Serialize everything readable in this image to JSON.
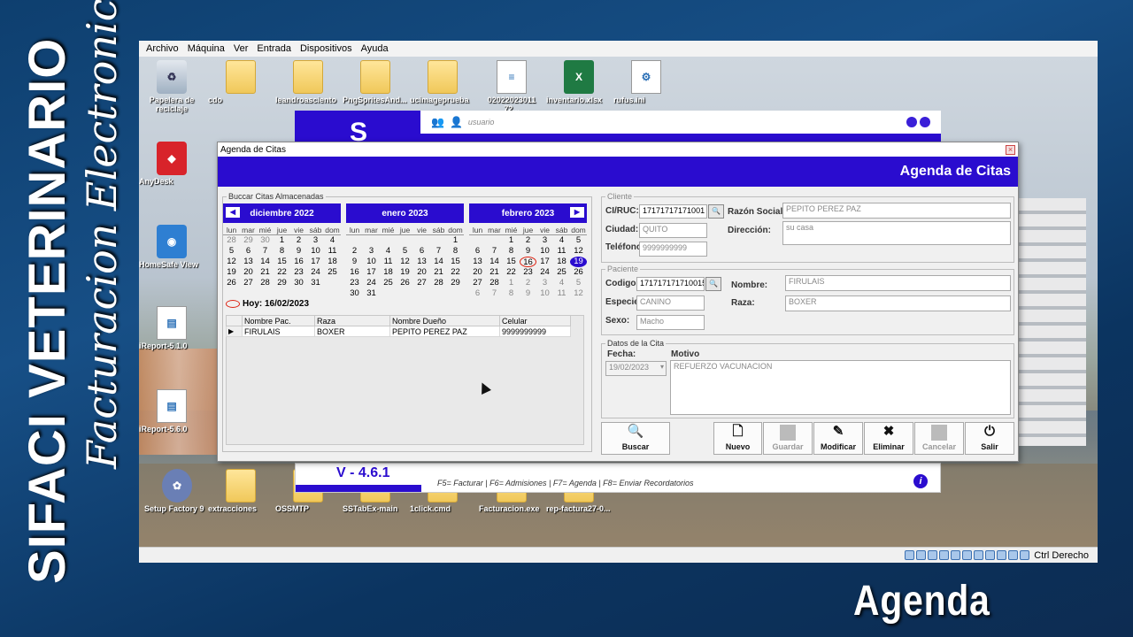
{
  "overlay": {
    "brand_title": "SIFACI VETERINARIO",
    "brand_subtitle": "Facturacion Electronica",
    "corner_label": "Agenda"
  },
  "vm_menu": [
    "Archivo",
    "Máquina",
    "Ver",
    "Entrada",
    "Dispositivos",
    "Ayuda"
  ],
  "vm_status": {
    "host_key": "Ctrl Derecho"
  },
  "desktop_icons": [
    {
      "label": "Papelera de reciclaje",
      "icon": "recycle-bin-icon"
    },
    {
      "label": "cdo",
      "icon": "folder-icon"
    },
    {
      "label": "leandroasciento",
      "icon": "folder-icon"
    },
    {
      "label": "PngSpritesAnd...",
      "icon": "folder-icon"
    },
    {
      "label": "ucimageprueba",
      "icon": "folder-icon"
    },
    {
      "label": "02022023011 72...",
      "icon": "document-icon"
    },
    {
      "label": "inventario.xlsx",
      "icon": "excel-icon"
    },
    {
      "label": "rufus.ini",
      "icon": "settings-file-icon"
    },
    {
      "label": "AnyDesk",
      "icon": "anydesk-icon"
    },
    {
      "label": "HomeSafe View",
      "icon": "homesafe-icon"
    },
    {
      "label": "iReport-5.1.0",
      "icon": "ireport-icon"
    },
    {
      "label": "iReport-5.6.0",
      "icon": "ireport-icon"
    },
    {
      "label": "Setup Factory 9",
      "icon": "setup-factory-icon"
    },
    {
      "label": "extracciones",
      "icon": "folder-icon"
    },
    {
      "label": "OSSMTP",
      "icon": "folder-icon"
    },
    {
      "label": "SSTabEx-main",
      "icon": "folder-icon"
    },
    {
      "label": "1click.cmd",
      "icon": "folder-icon"
    },
    {
      "label": "Facturacion.exe",
      "icon": "folder-icon"
    },
    {
      "label": "rep-factura27-0...",
      "icon": "folder-icon"
    }
  ],
  "main_app": {
    "user": "usuario",
    "logo_letter": "S",
    "version": "V - 4.6.1",
    "shortcuts": "F5= Facturar | F6= Admisiones | F7= Agenda | F8= Enviar Recordatorios"
  },
  "dialog": {
    "window_title": "Agenda de Citas",
    "banner_title": "Agenda de Citas",
    "search_group_label": "Buccar Citas Almacenadas",
    "today_label": "Hoy: 16/02/2023",
    "calendars": [
      {
        "month": "diciembre 2022",
        "days": [
          "28",
          "29",
          "30",
          "1",
          "2",
          "3",
          "4",
          "5",
          "6",
          "7",
          "8",
          "9",
          "10",
          "11",
          "12",
          "13",
          "14",
          "15",
          "16",
          "17",
          "18",
          "19",
          "20",
          "21",
          "22",
          "23",
          "24",
          "25",
          "26",
          "27",
          "28",
          "29",
          "30",
          "31",
          ""
        ],
        "dim_leading": 3,
        "dim_trailing": 0
      },
      {
        "month": "enero 2023",
        "days": [
          "",
          "",
          "",
          "",
          "",
          "",
          "1",
          "2",
          "3",
          "4",
          "5",
          "6",
          "7",
          "8",
          "9",
          "10",
          "11",
          "12",
          "13",
          "14",
          "15",
          "16",
          "17",
          "18",
          "19",
          "20",
          "21",
          "22",
          "23",
          "24",
          "25",
          "26",
          "27",
          "28",
          "29",
          "30",
          "31"
        ],
        "dim_leading": 0,
        "dim_trailing": 0
      },
      {
        "month": "febrero 2023",
        "days": [
          "",
          "",
          "1",
          "2",
          "3",
          "4",
          "5",
          "6",
          "7",
          "8",
          "9",
          "10",
          "11",
          "12",
          "13",
          "14",
          "15",
          "16",
          "17",
          "18",
          "19",
          "20",
          "21",
          "22",
          "23",
          "24",
          "25",
          "26",
          "27",
          "28",
          "1",
          "2",
          "3",
          "4",
          "5",
          "6",
          "7",
          "8",
          "9",
          "10",
          "11",
          "12"
        ],
        "dim_leading": 0,
        "dim_trailing": 12,
        "today": "16",
        "selected": "19"
      }
    ],
    "weekdays": [
      "lun",
      "mar",
      "mié",
      "jue",
      "vie",
      "sáb",
      "dom"
    ],
    "appointments": {
      "columns": [
        "Nombre Pac.",
        "Raza",
        "Nombre Dueño",
        "Celular"
      ],
      "rows": [
        [
          "FIRULAIS",
          "BOXER",
          "PEPITO PEREZ PAZ",
          "9999999999"
        ]
      ]
    },
    "cliente": {
      "legend": "Cliente",
      "ci_label": "CI/RUC:",
      "ci_value": "17171717171001",
      "razon_label": "Razón Social:",
      "razon_value": "PEPITO PEREZ PAZ",
      "ciudad_label": "Ciudad:",
      "ciudad_value": "QUITO",
      "direccion_label": "Dirección:",
      "direccion_value": "su casa",
      "telefono_label": "Teléfono:",
      "telefono_value": "9999999999"
    },
    "paciente": {
      "legend": "Paciente",
      "codigo_label": "Codigo:",
      "codigo_value": "17171717171001551",
      "nombre_label": "Nombre:",
      "nombre_value": "FIRULAIS",
      "especie_label": "Especie:",
      "especie_value": "CANINO",
      "raza_label": "Raza:",
      "raza_value": "BOXER",
      "sexo_label": "Sexo:",
      "sexo_value": "Macho"
    },
    "cita": {
      "legend": "Datos de la Cita",
      "fecha_label": "Fecha:",
      "fecha_value": "19/02/2023",
      "motivo_label": "Motivo",
      "motivo_value": "REFUERZO VACUNACION"
    },
    "buttons": {
      "buscar": "Buscar",
      "nuevo": "Nuevo",
      "guardar": "Guardar",
      "modificar": "Modificar",
      "eliminar": "Eliminar",
      "cancelar": "Cancelar",
      "salir": "Salir"
    }
  }
}
